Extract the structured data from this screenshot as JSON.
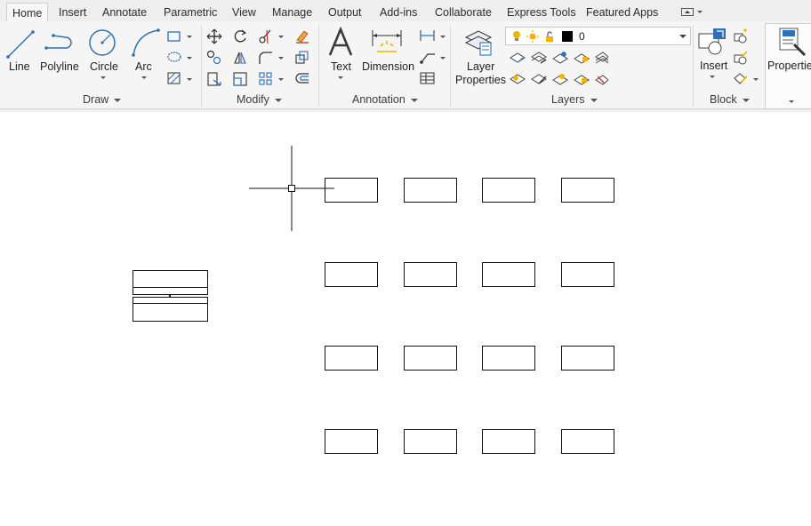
{
  "tabs": [
    {
      "label": "Home",
      "active": true
    },
    {
      "label": "Insert"
    },
    {
      "label": "Annotate"
    },
    {
      "label": "Parametric"
    },
    {
      "label": "View"
    },
    {
      "label": "Manage"
    },
    {
      "label": "Output"
    },
    {
      "label": "Add-ins"
    },
    {
      "label": "Collaborate"
    },
    {
      "label": "Express Tools"
    },
    {
      "label": "Featured Apps"
    }
  ],
  "draw": {
    "title": "Draw",
    "line": "Line",
    "polyline": "Polyline",
    "circle": "Circle",
    "arc": "Arc"
  },
  "modify": {
    "title": "Modify"
  },
  "annotation": {
    "title": "Annotation",
    "text": "Text",
    "dimension": "Dimension"
  },
  "layers": {
    "title": "Layers",
    "layer_properties_line1": "Layer",
    "layer_properties_line2": "Properties",
    "current_layer": "0",
    "current_color": "#000000"
  },
  "block": {
    "title": "Block",
    "insert": "Insert"
  },
  "properties": {
    "label": "Properties"
  },
  "colors": {
    "accent_blue": "#2f6fb3",
    "bulb_yellow": "#f2b400",
    "ribbon_bg": "#f5f5f5"
  }
}
